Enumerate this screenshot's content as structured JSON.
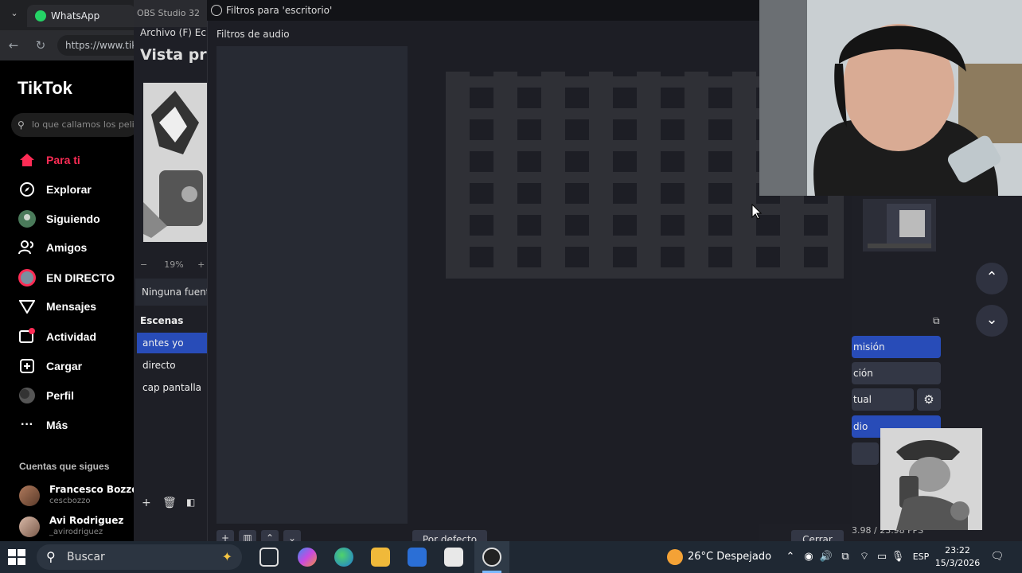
{
  "browser": {
    "tab_title": "WhatsApp",
    "url": "https://www.tiktok.com"
  },
  "tiktok": {
    "logo": "TikTok",
    "search_placeholder": "lo que callamos los pelis",
    "nav": [
      {
        "label": "Para ti",
        "icon": "home-icon"
      },
      {
        "label": "Explorar",
        "icon": "compass-icon"
      },
      {
        "label": "Siguiendo",
        "icon": "following-icon"
      },
      {
        "label": "Amigos",
        "icon": "friends-icon"
      },
      {
        "label": "EN DIRECTO",
        "icon": "live-icon"
      },
      {
        "label": "Mensajes",
        "icon": "messages-icon"
      },
      {
        "label": "Actividad",
        "icon": "activity-icon"
      },
      {
        "label": "Cargar",
        "icon": "upload-icon"
      },
      {
        "label": "Perfil",
        "icon": "profile-icon"
      },
      {
        "label": "Más",
        "icon": "more-icon"
      }
    ],
    "following_title": "Cuentas que sigues",
    "accounts": [
      {
        "name": "Francesco Bozzo",
        "handle": "cescbozzo"
      },
      {
        "name": "Avi Rodriguez",
        "handle": "_avirodriguez"
      }
    ]
  },
  "obs": {
    "title": "OBS Studio 32",
    "menu": "Archivo (F)   Ec",
    "preview_title": "Vista pre",
    "zoom": "19%",
    "no_source": "Ninguna fuente",
    "scenes_header": "Escenas",
    "scenes": [
      "antes yo",
      "directo",
      "cap pantalla"
    ],
    "controls": [
      "misión",
      "ción",
      "tual",
      "dio"
    ],
    "fps": "3.98 / 23.98 FPS"
  },
  "dialog": {
    "title": "Filtros para 'escritorio'",
    "section_label": "Filtros de audio",
    "default_button": "Por defecto",
    "close_button": "Cerrar"
  },
  "taskbar": {
    "search_label": "Buscar",
    "weather": "26°C  Despejado",
    "lang": "ESP",
    "time": "23:22",
    "date": "15/3/2026"
  }
}
